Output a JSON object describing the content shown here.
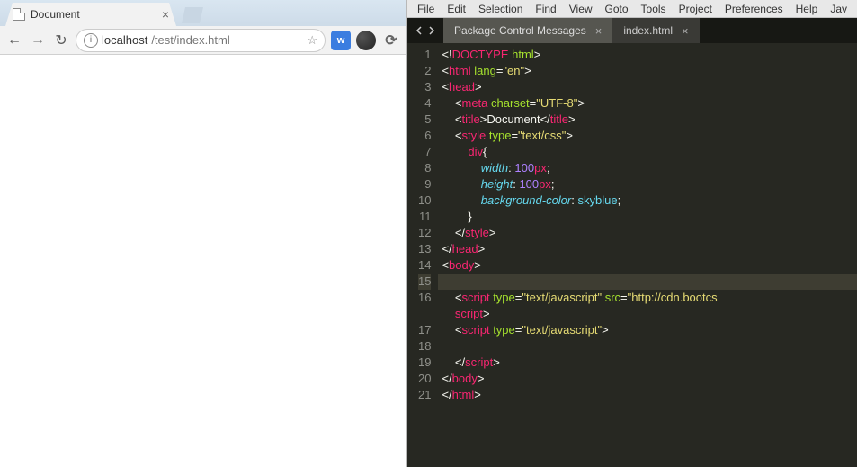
{
  "browser": {
    "tab_title": "Document",
    "newtab_icon": "new-tab",
    "nav": {
      "back": "←",
      "forward": "→",
      "reload": "↻"
    },
    "omnibox": {
      "info_icon": "i",
      "host": "localhost",
      "path": "/test/index.html",
      "star": "☆"
    },
    "extensions": {
      "w": "w",
      "spiral": "",
      "refresh": "⟳"
    }
  },
  "editor": {
    "menu": [
      "File",
      "Edit",
      "Selection",
      "Find",
      "View",
      "Goto",
      "Tools",
      "Project",
      "Preferences",
      "Help",
      "Jav"
    ],
    "tabs": [
      {
        "label": "Package Control Messages",
        "active": false
      },
      {
        "label": "index.html",
        "active": true
      }
    ],
    "active_line": 15,
    "lines": [
      {
        "n": 1,
        "indent": 0,
        "tokens": [
          [
            "punc",
            "<!"
          ],
          [
            "doctype",
            "DOCTYPE"
          ],
          [
            "punc",
            " "
          ],
          [
            "attr",
            "html"
          ],
          [
            "punc",
            ">"
          ]
        ]
      },
      {
        "n": 2,
        "indent": 0,
        "tokens": [
          [
            "punc",
            "<"
          ],
          [
            "tagn",
            "html"
          ],
          [
            "punc",
            " "
          ],
          [
            "attr",
            "lang"
          ],
          [
            "punc",
            "="
          ],
          [
            "str",
            "\"en\""
          ],
          [
            "punc",
            ">"
          ]
        ]
      },
      {
        "n": 3,
        "indent": 0,
        "tokens": [
          [
            "punc",
            "<"
          ],
          [
            "tagn",
            "head"
          ],
          [
            "punc",
            ">"
          ]
        ]
      },
      {
        "n": 4,
        "indent": 1,
        "tokens": [
          [
            "punc",
            "<"
          ],
          [
            "tagn",
            "meta"
          ],
          [
            "punc",
            " "
          ],
          [
            "attr",
            "charset"
          ],
          [
            "punc",
            "="
          ],
          [
            "str",
            "\"UTF-8\""
          ],
          [
            "punc",
            ">"
          ]
        ]
      },
      {
        "n": 5,
        "indent": 1,
        "tokens": [
          [
            "punc",
            "<"
          ],
          [
            "tagn",
            "title"
          ],
          [
            "punc",
            ">"
          ],
          [
            "punc",
            "Document"
          ],
          [
            "punc",
            "</"
          ],
          [
            "tagn",
            "title"
          ],
          [
            "punc",
            ">"
          ]
        ]
      },
      {
        "n": 6,
        "indent": 1,
        "tokens": [
          [
            "punc",
            "<"
          ],
          [
            "tagn",
            "style"
          ],
          [
            "punc",
            " "
          ],
          [
            "attr",
            "type"
          ],
          [
            "punc",
            "="
          ],
          [
            "str",
            "\"text/css\""
          ],
          [
            "punc",
            ">"
          ]
        ]
      },
      {
        "n": 7,
        "indent": 2,
        "tokens": [
          [
            "sel",
            "div"
          ],
          [
            "punc",
            "{"
          ]
        ]
      },
      {
        "n": 8,
        "indent": 3,
        "tokens": [
          [
            "prop",
            "width"
          ],
          [
            "punc",
            ": "
          ],
          [
            "num",
            "100"
          ],
          [
            "unit",
            "px"
          ],
          [
            "punc",
            ";"
          ]
        ]
      },
      {
        "n": 9,
        "indent": 3,
        "tokens": [
          [
            "prop",
            "height"
          ],
          [
            "punc",
            ": "
          ],
          [
            "num",
            "100"
          ],
          [
            "unit",
            "px"
          ],
          [
            "punc",
            ";"
          ]
        ]
      },
      {
        "n": 10,
        "indent": 3,
        "tokens": [
          [
            "prop",
            "background-color"
          ],
          [
            "punc",
            ": "
          ],
          [
            "val",
            "skyblue"
          ],
          [
            "punc",
            ";"
          ]
        ]
      },
      {
        "n": 11,
        "indent": 2,
        "tokens": [
          [
            "punc",
            "}"
          ]
        ]
      },
      {
        "n": 12,
        "indent": 1,
        "tokens": [
          [
            "punc",
            "</"
          ],
          [
            "tagn",
            "style"
          ],
          [
            "punc",
            ">"
          ]
        ]
      },
      {
        "n": 13,
        "indent": 0,
        "tokens": [
          [
            "punc",
            "</"
          ],
          [
            "tagn",
            "head"
          ],
          [
            "punc",
            ">"
          ]
        ]
      },
      {
        "n": 14,
        "indent": 0,
        "tokens": [
          [
            "punc",
            "<"
          ],
          [
            "tagn",
            "body"
          ],
          [
            "punc",
            ">"
          ]
        ]
      },
      {
        "n": 15,
        "indent": 0,
        "tokens": []
      },
      {
        "n": 16,
        "indent": 1,
        "tokens": [
          [
            "punc",
            "<"
          ],
          [
            "tagn",
            "script"
          ],
          [
            "punc",
            " "
          ],
          [
            "attr",
            "type"
          ],
          [
            "punc",
            "="
          ],
          [
            "str",
            "\"text/javascript\""
          ],
          [
            "punc",
            " "
          ],
          [
            "attr",
            "src"
          ],
          [
            "punc",
            "="
          ],
          [
            "str",
            "\"http://cdn.bootcs"
          ]
        ]
      },
      {
        "n": "",
        "indent": 1,
        "tokens": [
          [
            "tagn",
            "script"
          ],
          [
            "punc",
            ">"
          ]
        ]
      },
      {
        "n": 17,
        "indent": 1,
        "tokens": [
          [
            "punc",
            "<"
          ],
          [
            "tagn",
            "script"
          ],
          [
            "punc",
            " "
          ],
          [
            "attr",
            "type"
          ],
          [
            "punc",
            "="
          ],
          [
            "str",
            "\"text/javascript\""
          ],
          [
            "punc",
            ">"
          ]
        ]
      },
      {
        "n": 18,
        "indent": 0,
        "tokens": []
      },
      {
        "n": 19,
        "indent": 1,
        "tokens": [
          [
            "punc",
            "</"
          ],
          [
            "tagn",
            "script"
          ],
          [
            "punc",
            ">"
          ]
        ]
      },
      {
        "n": 20,
        "indent": 0,
        "tokens": [
          [
            "punc",
            "</"
          ],
          [
            "tagn",
            "body"
          ],
          [
            "punc",
            ">"
          ]
        ]
      },
      {
        "n": 21,
        "indent": 0,
        "tokens": [
          [
            "punc",
            "</"
          ],
          [
            "tagn",
            "html"
          ],
          [
            "punc",
            ">"
          ]
        ]
      }
    ]
  }
}
